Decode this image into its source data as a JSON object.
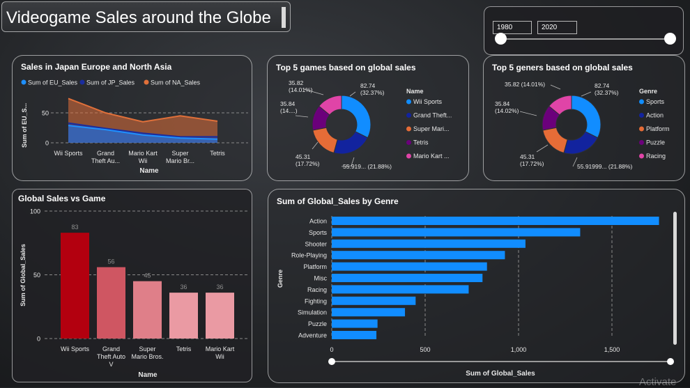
{
  "header": {
    "title": "Videogame Sales around the Globe"
  },
  "slicer": {
    "start": "1980",
    "end": "2020"
  },
  "watermark": "Activate",
  "colors": {
    "eu": "#1e90ff",
    "jp": "#1a2d9e",
    "na": "#e0703a",
    "accent": "#118dff"
  },
  "chart_data": [
    {
      "id": "area",
      "type": "area",
      "title": "Sales in Japan Europe and North Asia",
      "categories": [
        "Wii Sports",
        "Grand Theft Au...",
        "Mario Kart Wii",
        "Super Mario Br...",
        "Tetris"
      ],
      "category_lines": [
        [
          "Wii Sports"
        ],
        [
          "Grand",
          "Theft Au..."
        ],
        [
          "Mario Kart",
          "Wii"
        ],
        [
          "Super",
          "Mario Br..."
        ],
        [
          "Tetris"
        ]
      ],
      "series": [
        {
          "name": "Sum of EU_Sales",
          "values": [
            29,
            22,
            13,
            8,
            6
          ]
        },
        {
          "name": "Sum of JP_Sales",
          "values": [
            33,
            24,
            16,
            10,
            10
          ]
        },
        {
          "name": "Sum of NA_Sales",
          "values": [
            74,
            50,
            35,
            45,
            36
          ]
        }
      ],
      "xlabel": "Name",
      "ylabel": "Sum of EU_S...",
      "yticks": [
        "0",
        "50"
      ],
      "ylim": [
        0,
        90
      ]
    },
    {
      "id": "donut-games",
      "type": "pie",
      "title": "Top 5 games based on global sales",
      "legend_title": "Name",
      "slices": [
        {
          "name": "Wii Sports",
          "legend": "Wii Sports",
          "value": 82.74,
          "pct": "32.37%",
          "label": [
            "82.74",
            "(32.37%)"
          ]
        },
        {
          "name": "Grand Theft Auto V",
          "legend": "Grand Theft...",
          "value": 55.92,
          "pct": "21.88%",
          "label": [
            "55.919... (21.88%)"
          ]
        },
        {
          "name": "Super Mario Bros.",
          "legend": "Super Mari...",
          "value": 45.31,
          "pct": "17.72%",
          "label": [
            "45.31",
            "(17.72%)"
          ]
        },
        {
          "name": "Tetris",
          "legend": "Tetris",
          "value": 35.84,
          "pct": "14.0...%",
          "label": [
            "35.84",
            "(14....)"
          ]
        },
        {
          "name": "Mario Kart Wii",
          "legend": "Mario Kart ...",
          "value": 35.82,
          "pct": "14.01%",
          "label": [
            "35.82",
            "(14.01%)"
          ]
        }
      ]
    },
    {
      "id": "donut-genres",
      "type": "pie",
      "title": "Top 5 geners based on global sales",
      "legend_title": "Genre",
      "slices": [
        {
          "name": "Sports",
          "legend": "Sports",
          "value": 82.74,
          "pct": "32.37%",
          "label": [
            "82.74",
            "(32.37%)"
          ]
        },
        {
          "name": "Action",
          "legend": "Action",
          "value": 55.92,
          "pct": "21.88%",
          "label": [
            "55.91999... (21.88%)"
          ]
        },
        {
          "name": "Platform",
          "legend": "Platform",
          "value": 45.31,
          "pct": "17.72%",
          "label": [
            "45.31",
            "(17.72%)"
          ]
        },
        {
          "name": "Puzzle",
          "legend": "Puzzle",
          "value": 35.84,
          "pct": "14.02%",
          "label": [
            "35.84",
            "(14.02%)"
          ]
        },
        {
          "name": "Racing",
          "legend": "Racing",
          "value": 35.82,
          "pct": "14.01%",
          "label": [
            "35.82 (14.01%)"
          ]
        }
      ]
    },
    {
      "id": "bar-games",
      "type": "bar",
      "title": "Global Sales vs Game",
      "categories": [
        "Wii Sports",
        "Grand Theft Auto V",
        "Super Mario Bros.",
        "Tetris",
        "Mario Kart Wii"
      ],
      "category_lines": [
        [
          "Wii Sports"
        ],
        [
          "Grand",
          "Theft Auto",
          "V"
        ],
        [
          "Super",
          "Mario Bros."
        ],
        [
          "Tetris"
        ],
        [
          "Mario Kart",
          "Wii"
        ]
      ],
      "values": [
        83,
        56,
        45,
        36,
        36
      ],
      "colors": [
        "#b3000f",
        "#cf5662",
        "#df7f89",
        "#ea9aa3",
        "#ea9aa3"
      ],
      "xlabel": "Name",
      "ylabel": "Sum of Global_Sales",
      "yticks": [
        "0",
        "50",
        "100"
      ],
      "ylim": [
        0,
        100
      ]
    },
    {
      "id": "hbar-genre",
      "type": "bar",
      "orientation": "horizontal",
      "title": "Sum of Global_Sales by Genre",
      "categories": [
        "Action",
        "Sports",
        "Shooter",
        "Role-Playing",
        "Platform",
        "Misc",
        "Racing",
        "Fighting",
        "Simulation",
        "Puzzle",
        "Adventure"
      ],
      "values": [
        1752,
        1330,
        1037,
        927,
        831,
        807,
        733,
        449,
        392,
        245,
        239
      ],
      "xlabel": "Sum of Global_Sales",
      "ylabel": "Genre",
      "xticks": [
        "0",
        "500",
        "1,000",
        "1,500"
      ],
      "xlim": [
        0,
        1790
      ]
    }
  ]
}
